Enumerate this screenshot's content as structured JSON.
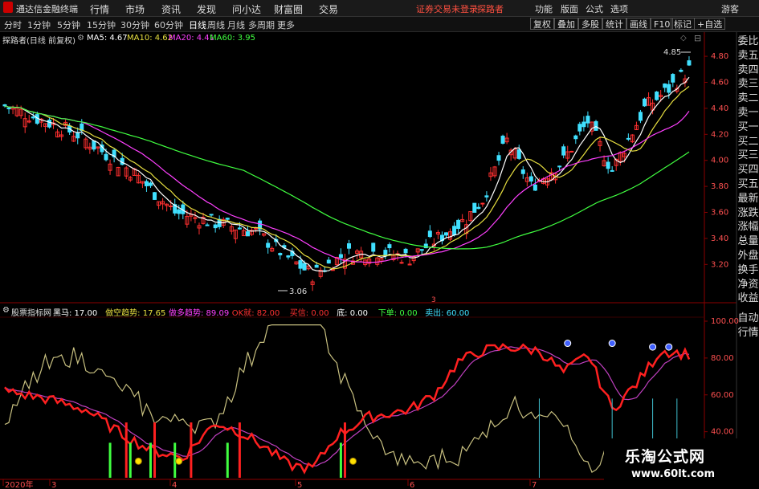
{
  "app": {
    "title": "通达信金融终端",
    "menu": [
      "行情",
      "市场",
      "资讯",
      "发现",
      "问小达",
      "财富圈",
      "交易"
    ],
    "warning": "证券交易未登录",
    "stock_name_top": "探路者",
    "right_menu": [
      "功能",
      "版面",
      "公式",
      "选项"
    ],
    "guest": "游客"
  },
  "periods": {
    "items": [
      "分时",
      "1分钟",
      "5分钟",
      "15分钟",
      "30分钟",
      "60分钟",
      "日线",
      "周线",
      "月线",
      "多周期",
      "更多"
    ],
    "active": "日线",
    "right_buttons": [
      "复权",
      "叠加",
      "多股",
      "统计",
      "画线",
      "F10",
      "标记",
      "+自选"
    ]
  },
  "main_chart": {
    "header": "探路者(日线 前复权)",
    "ma": [
      {
        "label": "MA5: 4.67",
        "color": "#ffffff"
      },
      {
        "label": "MA10: 4.62",
        "color": "#e8e040"
      },
      {
        "label": "MA20: 4.41",
        "color": "#ff40ff"
      },
      {
        "label": "MA60: 3.95",
        "color": "#40ff40"
      }
    ],
    "price_axis": [
      "4.80",
      "4.60",
      "4.40",
      "4.20",
      "4.00",
      "3.80",
      "3.60",
      "3.40",
      "3.20"
    ],
    "high_label": "4.85",
    "low_label": "3.06",
    "marker": "3"
  },
  "indicator": {
    "name": "股票指标网",
    "items": [
      {
        "label": "黑马: 17.00",
        "color": "#ffffff"
      },
      {
        "label": "做空趋势: 17.65",
        "color": "#e8e040"
      },
      {
        "label": "做多趋势: 89.09",
        "color": "#ff40ff"
      },
      {
        "label": "OK就: 82.00",
        "color": "#ff3030"
      },
      {
        "label": "买信: 0.00",
        "color": "#ff3030"
      },
      {
        "label": "底: 0.00",
        "color": "#ffffff"
      },
      {
        "label": "下单: 0.00",
        "color": "#40ff40"
      },
      {
        "label": "卖出: 60.00",
        "color": "#40e0ff"
      }
    ],
    "axis": [
      "100.00",
      "80.00",
      "60.00",
      "40.00"
    ],
    "side": [
      "自动",
      "行情"
    ]
  },
  "side_panel": [
    "委比",
    "卖五",
    "卖四",
    "卖三",
    "卖二",
    "卖一",
    "买一",
    "买二",
    "买三",
    "买四",
    "买五",
    "最新",
    "涨跌",
    "涨幅",
    "总量",
    "外盘",
    "换手",
    "净资",
    "收益"
  ],
  "date_axis": [
    "2020年",
    "3",
    "4",
    "5",
    "6",
    "7"
  ],
  "watermark": {
    "cn": "乐淘公式网",
    "url": "www.60lt.com"
  },
  "colors": {
    "up": "#ff3030",
    "down": "#40e0ff",
    "ma5": "#ffffff",
    "ma10": "#e8e040",
    "ma20": "#ff40ff",
    "ma60": "#40ff40",
    "grid": "#8b0000"
  }
}
